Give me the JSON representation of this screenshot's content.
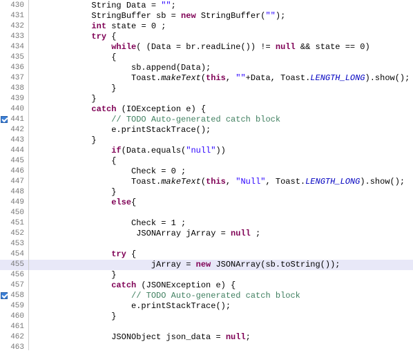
{
  "lines": [
    {
      "num": "430",
      "seg": [
        {
          "t": "            String Data = "
        },
        {
          "t": "\"\"",
          "c": "str"
        },
        {
          "t": ";"
        }
      ]
    },
    {
      "num": "431",
      "seg": [
        {
          "t": "            StringBuffer sb = "
        },
        {
          "t": "new",
          "c": "kw"
        },
        {
          "t": " StringBuffer("
        },
        {
          "t": "\"\"",
          "c": "str"
        },
        {
          "t": ");"
        }
      ]
    },
    {
      "num": "432",
      "seg": [
        {
          "t": "            "
        },
        {
          "t": "int",
          "c": "kw"
        },
        {
          "t": " state = 0 ;"
        }
      ]
    },
    {
      "num": "433",
      "seg": [
        {
          "t": "            "
        },
        {
          "t": "try",
          "c": "kw"
        },
        {
          "t": " {"
        }
      ]
    },
    {
      "num": "434",
      "seg": [
        {
          "t": "                "
        },
        {
          "t": "while",
          "c": "kw"
        },
        {
          "t": "( (Data = br.readLine()) != "
        },
        {
          "t": "null",
          "c": "kw"
        },
        {
          "t": " && state == 0)"
        }
      ]
    },
    {
      "num": "435",
      "seg": [
        {
          "t": "                {"
        }
      ]
    },
    {
      "num": "436",
      "seg": [
        {
          "t": "                    sb.append(Data);"
        }
      ]
    },
    {
      "num": "437",
      "seg": [
        {
          "t": "                    Toast."
        },
        {
          "t": "makeText",
          "c": "it"
        },
        {
          "t": "("
        },
        {
          "t": "this",
          "c": "kw"
        },
        {
          "t": ", "
        },
        {
          "t": "\"\"",
          "c": "str"
        },
        {
          "t": "+Data, Toast."
        },
        {
          "t": "LENGTH_LONG",
          "c": "static"
        },
        {
          "t": ").show();"
        }
      ]
    },
    {
      "num": "438",
      "seg": [
        {
          "t": "                }"
        }
      ]
    },
    {
      "num": "439",
      "seg": [
        {
          "t": "            }"
        }
      ]
    },
    {
      "num": "440",
      "seg": [
        {
          "t": "            "
        },
        {
          "t": "catch",
          "c": "kw"
        },
        {
          "t": " (IOException e) {"
        }
      ]
    },
    {
      "num": "441",
      "marker": true,
      "seg": [
        {
          "t": "                "
        },
        {
          "t": "// TODO Auto-generated catch block",
          "c": "com"
        }
      ]
    },
    {
      "num": "442",
      "seg": [
        {
          "t": "                e.printStackTrace();"
        }
      ]
    },
    {
      "num": "443",
      "seg": [
        {
          "t": "            }"
        }
      ]
    },
    {
      "num": "444",
      "seg": [
        {
          "t": "                "
        },
        {
          "t": "if",
          "c": "kw"
        },
        {
          "t": "(Data.equals("
        },
        {
          "t": "\"null\"",
          "c": "str"
        },
        {
          "t": "))"
        }
      ]
    },
    {
      "num": "445",
      "seg": [
        {
          "t": "                {"
        }
      ]
    },
    {
      "num": "446",
      "seg": [
        {
          "t": "                    Check = 0 ;"
        }
      ]
    },
    {
      "num": "447",
      "seg": [
        {
          "t": "                    Toast."
        },
        {
          "t": "makeText",
          "c": "it"
        },
        {
          "t": "("
        },
        {
          "t": "this",
          "c": "kw"
        },
        {
          "t": ", "
        },
        {
          "t": "\"Null\"",
          "c": "str"
        },
        {
          "t": ", Toast."
        },
        {
          "t": "LENGTH_LONG",
          "c": "static"
        },
        {
          "t": ").show();"
        }
      ]
    },
    {
      "num": "448",
      "seg": [
        {
          "t": "                }"
        }
      ]
    },
    {
      "num": "449",
      "seg": [
        {
          "t": "                "
        },
        {
          "t": "else",
          "c": "kw"
        },
        {
          "t": "{"
        }
      ]
    },
    {
      "num": "450",
      "seg": [
        {
          "t": ""
        }
      ]
    },
    {
      "num": "451",
      "seg": [
        {
          "t": "                    Check = 1 ;"
        }
      ]
    },
    {
      "num": "452",
      "seg": [
        {
          "t": "                     JSONArray jArray = "
        },
        {
          "t": "null",
          "c": "kw"
        },
        {
          "t": " ;"
        }
      ]
    },
    {
      "num": "453",
      "seg": [
        {
          "t": ""
        }
      ]
    },
    {
      "num": "454",
      "seg": [
        {
          "t": "                "
        },
        {
          "t": "try",
          "c": "kw"
        },
        {
          "t": " {"
        }
      ]
    },
    {
      "num": "455",
      "highlighted": true,
      "seg": [
        {
          "t": "                        jArray = "
        },
        {
          "t": "new",
          "c": "kw"
        },
        {
          "t": " JSONArray(sb.toString());"
        }
      ]
    },
    {
      "num": "456",
      "seg": [
        {
          "t": "                }"
        }
      ]
    },
    {
      "num": "457",
      "seg": [
        {
          "t": "                "
        },
        {
          "t": "catch",
          "c": "kw"
        },
        {
          "t": " (JSONException e) {"
        }
      ]
    },
    {
      "num": "458",
      "marker": true,
      "seg": [
        {
          "t": "                    "
        },
        {
          "t": "// TODO Auto-generated catch block",
          "c": "com"
        }
      ]
    },
    {
      "num": "459",
      "seg": [
        {
          "t": "                    e.printStackTrace();"
        }
      ]
    },
    {
      "num": "460",
      "seg": [
        {
          "t": "                }"
        }
      ]
    },
    {
      "num": "461",
      "seg": [
        {
          "t": ""
        }
      ]
    },
    {
      "num": "462",
      "seg": [
        {
          "t": "                JSONObject json_data = "
        },
        {
          "t": "null",
          "c": "kw"
        },
        {
          "t": ";"
        }
      ]
    },
    {
      "num": "463",
      "seg": [
        {
          "t": ""
        }
      ]
    }
  ]
}
